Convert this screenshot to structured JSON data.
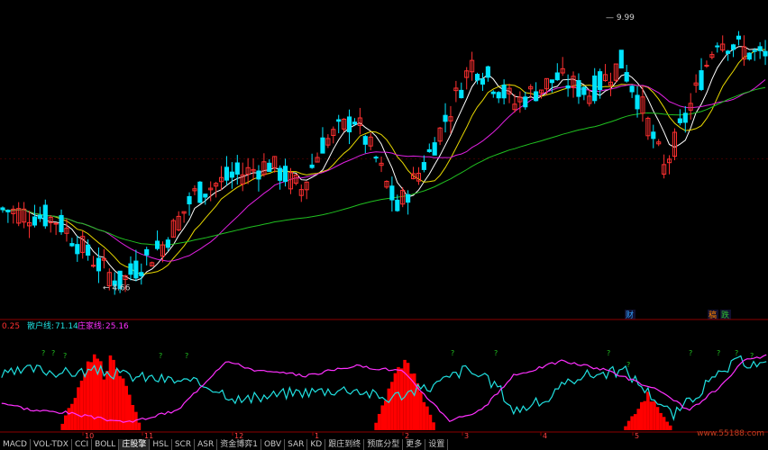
{
  "chart_data": [
    {
      "type": "candlestick",
      "name_note": "main price panel",
      "price_labels": {
        "high": "9.99",
        "low": "4.66"
      },
      "ylim": [
        4.2,
        10.2
      ],
      "x_ticks": [
        "10",
        "11",
        "12",
        "1",
        "2",
        "3",
        "4",
        "5"
      ],
      "event_badges": [
        "财",
        "稿",
        "跌"
      ],
      "overlay_lines": [
        "MA5",
        "MA10",
        "MA20",
        "MA60"
      ]
    },
    {
      "type": "line",
      "name_note": "indicator panel",
      "header": {
        "value0": "0.25",
        "s1_label": "散户线:",
        "s1_value": "71.14",
        "s2_label": "庄家线:",
        "s2_value": "25.16"
      },
      "marker_glyph": "?",
      "ylim": [
        0,
        100
      ]
    }
  ],
  "tabs": [
    "MACD",
    "VOL-TDX",
    "CCI",
    "BOLL",
    "庄股擎",
    "HSL",
    "SCR",
    "ASR",
    "资金博弈1",
    "OBV",
    "SAR",
    "KD",
    "跟庄到终",
    "预底分型",
    "更多",
    "设置"
  ],
  "watermark": "www.55188.com",
  "colors": {
    "up": "#ff3030",
    "down": "#00e4ff",
    "ma5": "#ffffff",
    "ma10": "#e8d800",
    "ma20": "#e020e0",
    "ma60": "#20c020",
    "retail": "#20e0e0",
    "dealer": "#ff30ff",
    "bars": "#ff0000",
    "grid": "#8b0000"
  }
}
